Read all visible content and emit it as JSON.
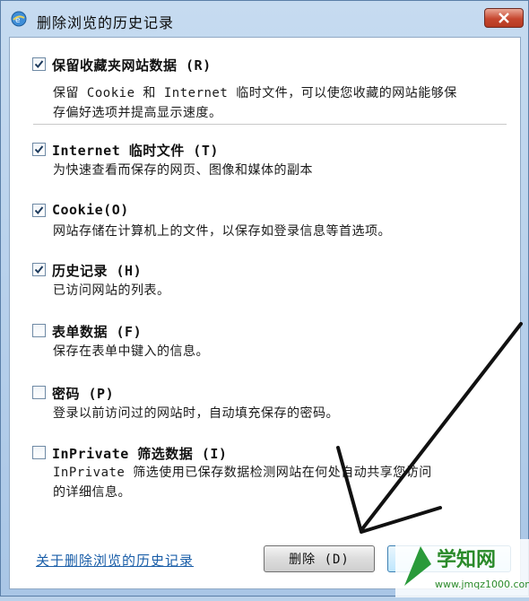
{
  "window": {
    "title": "删除浏览的历史记录"
  },
  "options": [
    {
      "title": "保留收藏夹网站数据 (R)",
      "desc": [
        "保留 Cookie 和 Internet 临时文件，可以使您收藏的网站能够保",
        "存偏好选项并提高显示速度。"
      ],
      "checked": true
    },
    {
      "title": "Internet 临时文件 (T)",
      "desc": [
        "为快速查看而保存的网页、图像和媒体的副本"
      ],
      "checked": true
    },
    {
      "title": "Cookie(O)",
      "desc": [
        "网站存储在计算机上的文件，以保存如登录信息等首选项。"
      ],
      "checked": true
    },
    {
      "title": "历史记录 (H)",
      "desc": [
        "已访问网站的列表。"
      ],
      "checked": true
    },
    {
      "title": "表单数据 (F)",
      "desc": [
        "保存在表单中键入的信息。"
      ],
      "checked": false
    },
    {
      "title": "密码 (P)",
      "desc": [
        "登录以前访问过的网站时，自动填充保存的密码。"
      ],
      "checked": false
    },
    {
      "title": "InPrivate 筛选数据 (I)",
      "desc": [
        "InPrivate 筛选使用已保存数据检测网站在何处自动共享您访问",
        "的详细信息。"
      ],
      "checked": false
    }
  ],
  "footer": {
    "link": "关于删除浏览的历史记录",
    "delete_button": "删除 (D)"
  },
  "watermark": {
    "text": "学知网",
    "url_text": "www.jmqz1000.com"
  },
  "colors": {
    "check": "#1d3a5c",
    "link": "#1a5ea8",
    "close": "#c6472f"
  },
  "icons": {
    "title": "ie-globe-icon",
    "close": "close-x-icon",
    "check": "checkmark-icon",
    "annotation": "hand-drawn-arrow"
  }
}
